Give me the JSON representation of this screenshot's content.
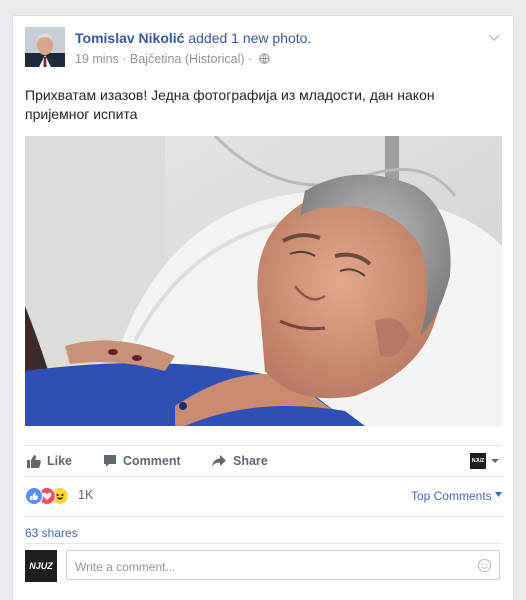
{
  "post": {
    "author": "Tomislav Nikolić",
    "action_text": "added 1 new photo.",
    "time": "19 mins",
    "meta_separator": "·",
    "location": "Bajčetina (Historical)",
    "text": "Прихватам изазов! Једна фотографија из младости, дан након пријемног испита"
  },
  "actions": {
    "like": "Like",
    "comment": "Comment",
    "share": "Share",
    "page_logo": "NJUZ"
  },
  "reactions": {
    "count": "1K",
    "top_comments": "Top Comments",
    "icons": [
      "like-reaction-icon",
      "love-reaction-icon",
      "haha-reaction-icon"
    ],
    "colors": {
      "like": "#5890ff",
      "love": "#f25268",
      "haha": "#fcd640"
    }
  },
  "shares": "63 shares",
  "comment": {
    "avatar_text": "NJUZ",
    "placeholder": "Write a comment..."
  },
  "colors": {
    "link": "#365899",
    "muted": "#90949c",
    "action": "#606770",
    "background": "#e9ebee"
  }
}
